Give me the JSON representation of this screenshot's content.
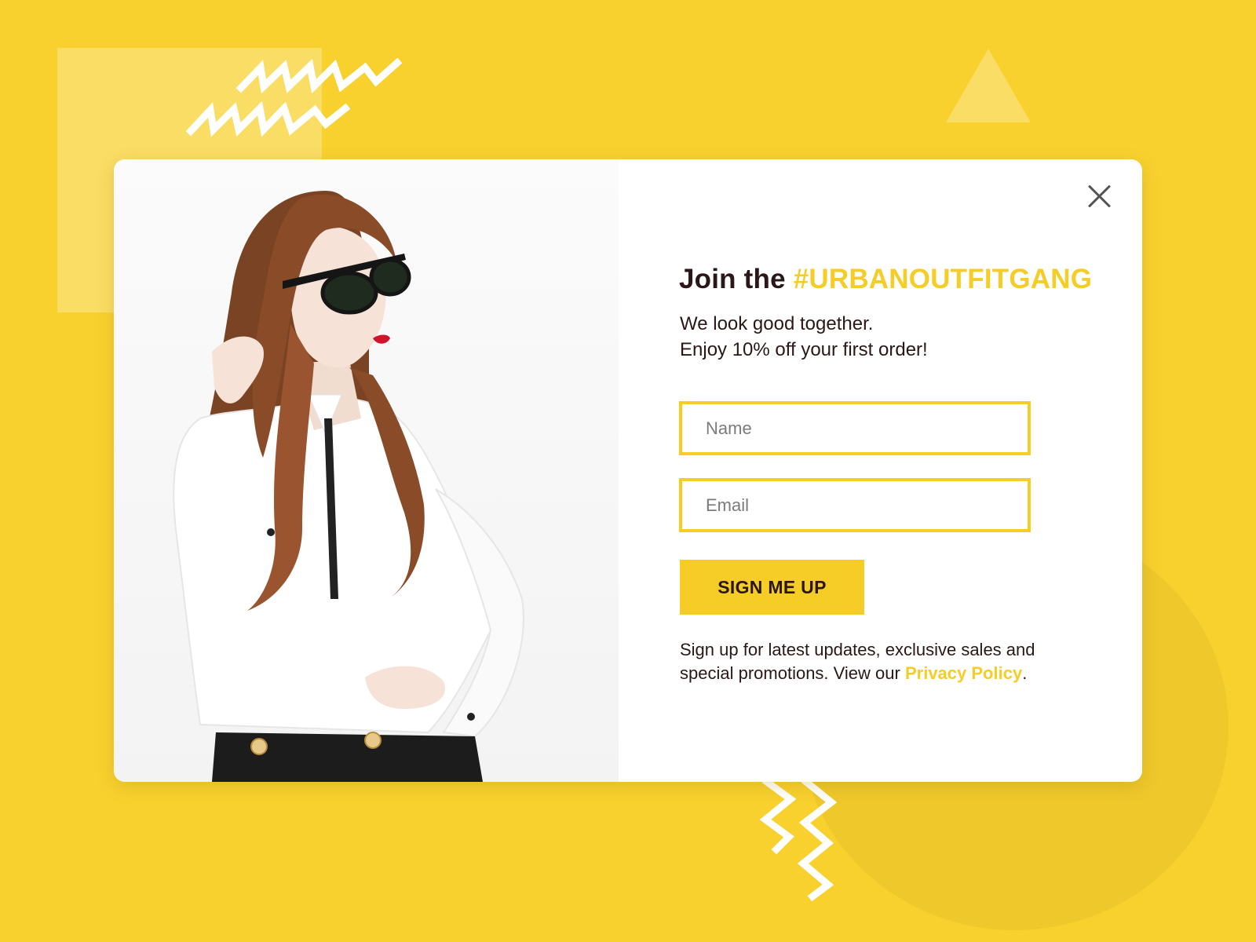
{
  "popup": {
    "headline_prefix": "Join the",
    "headline_hashtag": "#URBANOUTFITGANG",
    "subtext_line1": "We look good together.",
    "subtext_line2": "Enjoy 10% off your first order!",
    "name_field": {
      "placeholder": "Name",
      "value": ""
    },
    "email_field": {
      "placeholder": "Email",
      "value": ""
    },
    "submit_label": "SIGN ME UP",
    "footnote_text": "Sign up for latest updates, exclusive sales and special promotions. View our",
    "privacy_link": "Privacy Policy",
    "footnote_end": "."
  },
  "icons": {
    "close": "close-icon"
  },
  "colors": {
    "background": "#F8D12F",
    "accent": "#F6CC26",
    "text": "#2B1717",
    "card": "#FFFFFF"
  }
}
